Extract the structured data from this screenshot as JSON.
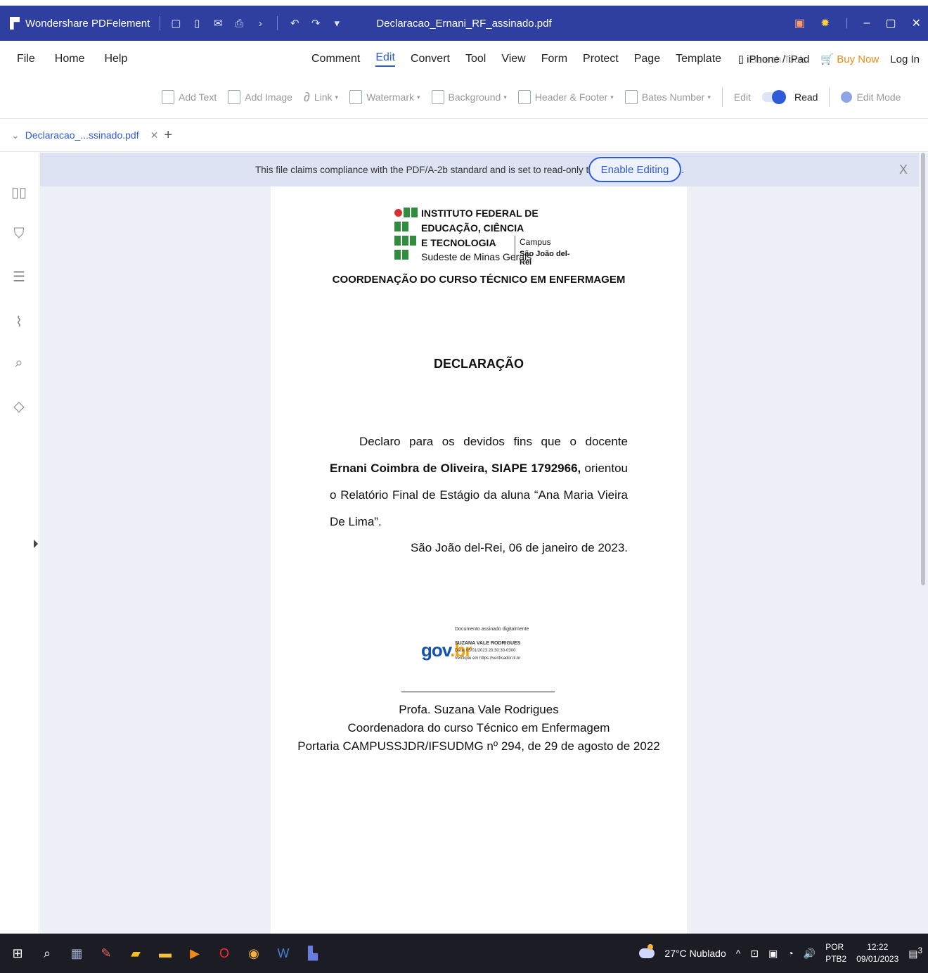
{
  "titlebar": {
    "app_name": "Wondershare PDFelement",
    "doc_title": "Declaracao_Ernani_RF_assinado.pdf",
    "quick_access": [
      "new-icon",
      "save-icon",
      "mail-icon",
      "print-icon",
      "share-icon",
      "undo-icon",
      "redo-icon",
      "customize-icon"
    ]
  },
  "menubar": {
    "left": [
      "File",
      "Home",
      "Help"
    ],
    "center": [
      "Comment",
      "Edit",
      "Convert",
      "Tool",
      "View",
      "Form",
      "Protect",
      "Page",
      "Template"
    ],
    "active": "Edit",
    "search_tools": "Search Tools",
    "iphone_ipad": "iPhone / iPad",
    "buy_now": "Buy Now",
    "login": "Log In"
  },
  "toolbar": {
    "add_text": "Add Text",
    "add_image": "Add Image",
    "link": "Link",
    "watermark": "Watermark",
    "background": "Background",
    "header_footer": "Header & Footer",
    "bates_number": "Bates Number",
    "edit": "Edit",
    "read": "Read",
    "edit_mode": "Edit Mode"
  },
  "tabs": {
    "current": "Declaracao_...ssinado.pdf"
  },
  "notice": {
    "message": "This file claims compliance with the PDF/A-2b standard and is set to read-only to prevent modification.",
    "enable_editing": "Enable Editing",
    "close": "X"
  },
  "document": {
    "logo": {
      "line1": "INSTITUTO FEDERAL DE",
      "line2": "EDUCAÇÃO, CIÊNCIA",
      "line3": "E TECNOLOGIA",
      "line4": "Sudeste de Minas Gerais",
      "campus": "Campus",
      "campus_name": "São João del-Rei"
    },
    "coordination": "COORDENAÇÃO DO CURSO TÉCNICO EM ENFERMAGEM",
    "title": "DECLARAÇÃO",
    "body_pre": "Declaro para os devidos fins que o docente ",
    "body_bold": "Ernani Coimbra de Oliveira, SIAPE 1792966,",
    "body_post": " orientou o Relatório Final de Estágio da aluna “Ana Maria Vieira De Lima”.",
    "date": "São João del-Rei, 06 de janeiro de 2023.",
    "govbr": {
      "logo_gov": "gov",
      "logo_br": ".br",
      "line1": "Documento assinado digitalmente",
      "line2": "SUZANA VALE RODRIGUES",
      "line3": "Data: 05/01/2023 20:30:30-0300",
      "line4": "Verifique em https://verificador.iti.br"
    },
    "signer_name": "Profa. Suzana Vale Rodrigues",
    "signer_role": "Coordenadora do curso Técnico em Enfermagem",
    "signer_portaria": "Portaria CAMPUSSJDR/IFSUDMG nº 294, de 29 de agosto de 2022"
  },
  "taskbar": {
    "weather": "27°C Nublado",
    "lang_top": "POR",
    "lang_bottom": "PTB2",
    "time": "12:22",
    "date": "09/01/2023",
    "notifications": "3"
  }
}
